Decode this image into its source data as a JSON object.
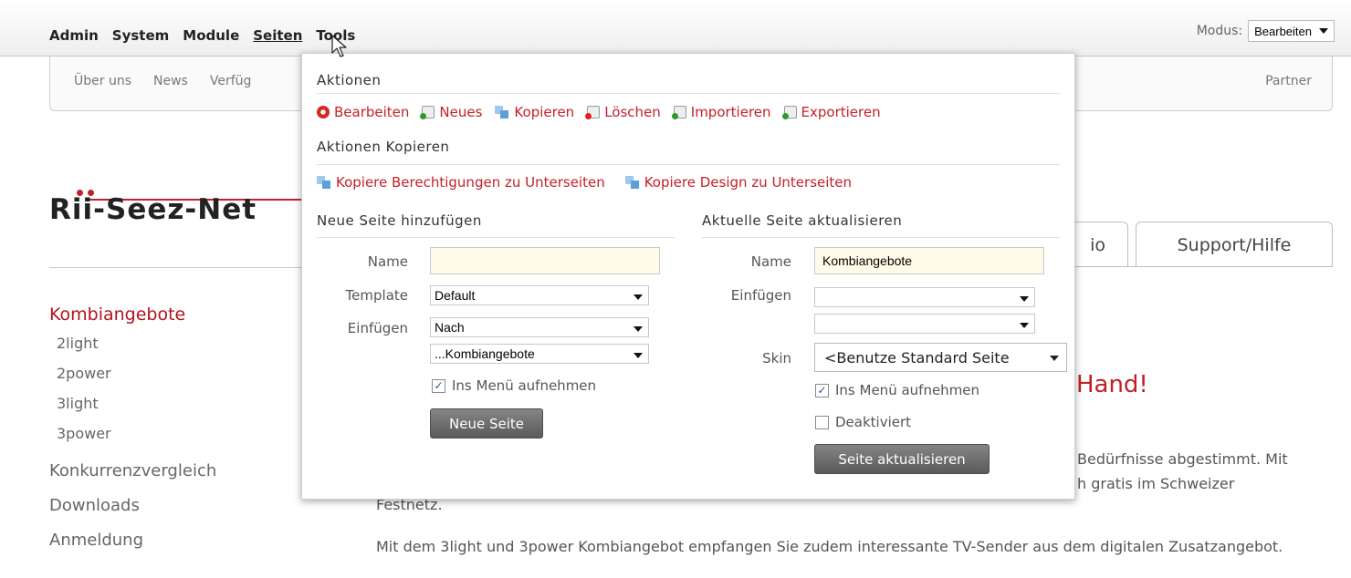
{
  "controlbar": {
    "menu": [
      "Admin",
      "System",
      "Module",
      "Seiten",
      "Tools"
    ],
    "modus_label": "Modus:",
    "modus_value": "Bearbeiten"
  },
  "sitenav": {
    "items": [
      "Über uns",
      "News",
      "Verfüg"
    ],
    "right_item": "Partner"
  },
  "logo": {
    "text": "Rii-Seez-Net"
  },
  "tabs": [
    "io",
    "Support/Hilfe"
  ],
  "sidebar": {
    "active": "Kombiangebote",
    "subitems": [
      "2light",
      "2power",
      "3light",
      "3power"
    ],
    "items": [
      "Konkurrenzvergleich",
      "Downloads",
      "Anmeldung"
    ]
  },
  "content": {
    "headline_fragment": "r Hand!",
    "line1_fragment": "Bedürfnisse abgestimmt. Mit",
    "line2_fragment": "h gratis im Schweizer",
    "cut_line": "Festnetz.",
    "paragraph": "Mit dem 3light und 3power Kombiangebot empfangen Sie zudem interessante TV-Sender aus dem digitalen Zusatzangebot."
  },
  "panel": {
    "actions_title": "Aktionen",
    "actions": [
      {
        "label": "Bearbeiten",
        "icon": "gear-icon"
      },
      {
        "label": "Neues",
        "icon": "new-page-icon"
      },
      {
        "label": "Kopieren",
        "icon": "copy-icon"
      },
      {
        "label": "Löschen",
        "icon": "delete-page-icon"
      },
      {
        "label": "Importieren",
        "icon": "import-icon"
      },
      {
        "label": "Exportieren",
        "icon": "export-icon"
      }
    ],
    "copy_title": "Aktionen Kopieren",
    "copy_actions": [
      {
        "label": "Kopiere Berechtigungen zu Unterseiten",
        "icon": "copy-icon"
      },
      {
        "label": "Kopiere Design zu Unterseiten",
        "icon": "copy-icon"
      }
    ],
    "new_page": {
      "title": "Neue Seite hinzufügen",
      "name_label": "Name",
      "name_value": "",
      "template_label": "Template",
      "template_value": "Default",
      "insert_label": "Einfügen",
      "insert_value": "Nach",
      "insert_ref_value": "...Kombiangebote",
      "menu_checkbox_label": "Ins Menü aufnehmen",
      "menu_checked": true,
      "button": "Neue Seite"
    },
    "update_page": {
      "title": "Aktuelle Seite aktualisieren",
      "name_label": "Name",
      "name_value": "Kombiangebote",
      "insert_label": "Einfügen",
      "insert_value": "",
      "insert_ref_value": "",
      "skin_label": "Skin",
      "skin_value": "<Benutze Standard Seite",
      "menu_checkbox_label": "Ins Menü aufnehmen",
      "menu_checked": true,
      "deactivated_label": "Deaktiviert",
      "deactivated_checked": false,
      "button": "Seite aktualisieren"
    }
  },
  "colors": {
    "accent_red": "#c42027",
    "button_gray": "#6b6b6b",
    "input_highlight": "#fffbe8"
  }
}
